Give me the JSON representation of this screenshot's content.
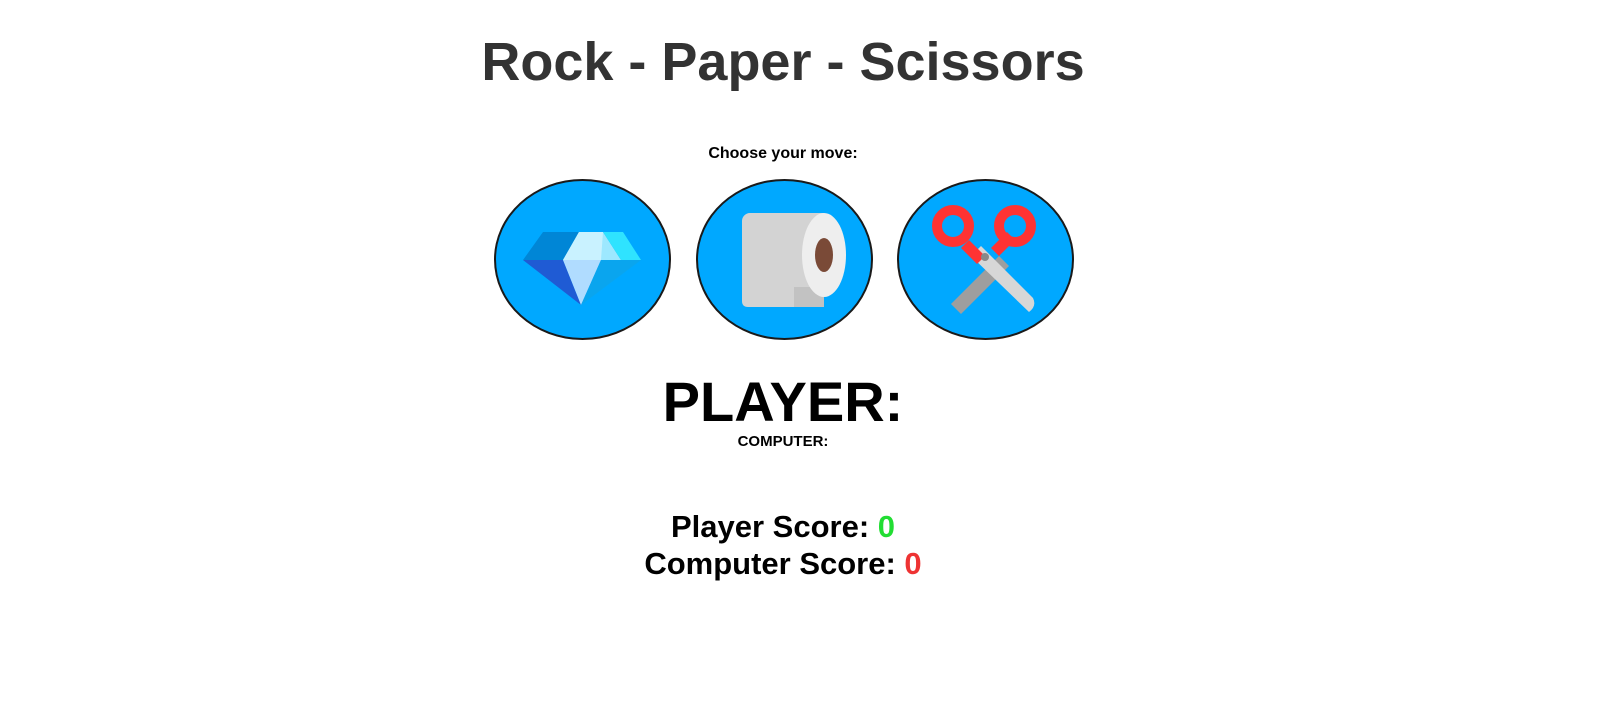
{
  "header": {
    "title": "Rock - Paper - Scissors"
  },
  "moves": {
    "prompt": "Choose your move:",
    "options": [
      {
        "name": "rock",
        "icon": "diamond-icon"
      },
      {
        "name": "paper",
        "icon": "toilet-paper-icon"
      },
      {
        "name": "scissors",
        "icon": "scissors-icon"
      }
    ]
  },
  "result": {
    "player_label": "PLAYER:",
    "computer_label": "COMPUTER:"
  },
  "score": {
    "player_label": "Player Score:",
    "player_value": "0",
    "computer_label": "Computer Score:",
    "computer_value": "0"
  },
  "colors": {
    "button_bg": "#00a8ff",
    "player_score": "#22dd33",
    "computer_score": "#ee3333",
    "title": "#333333"
  }
}
